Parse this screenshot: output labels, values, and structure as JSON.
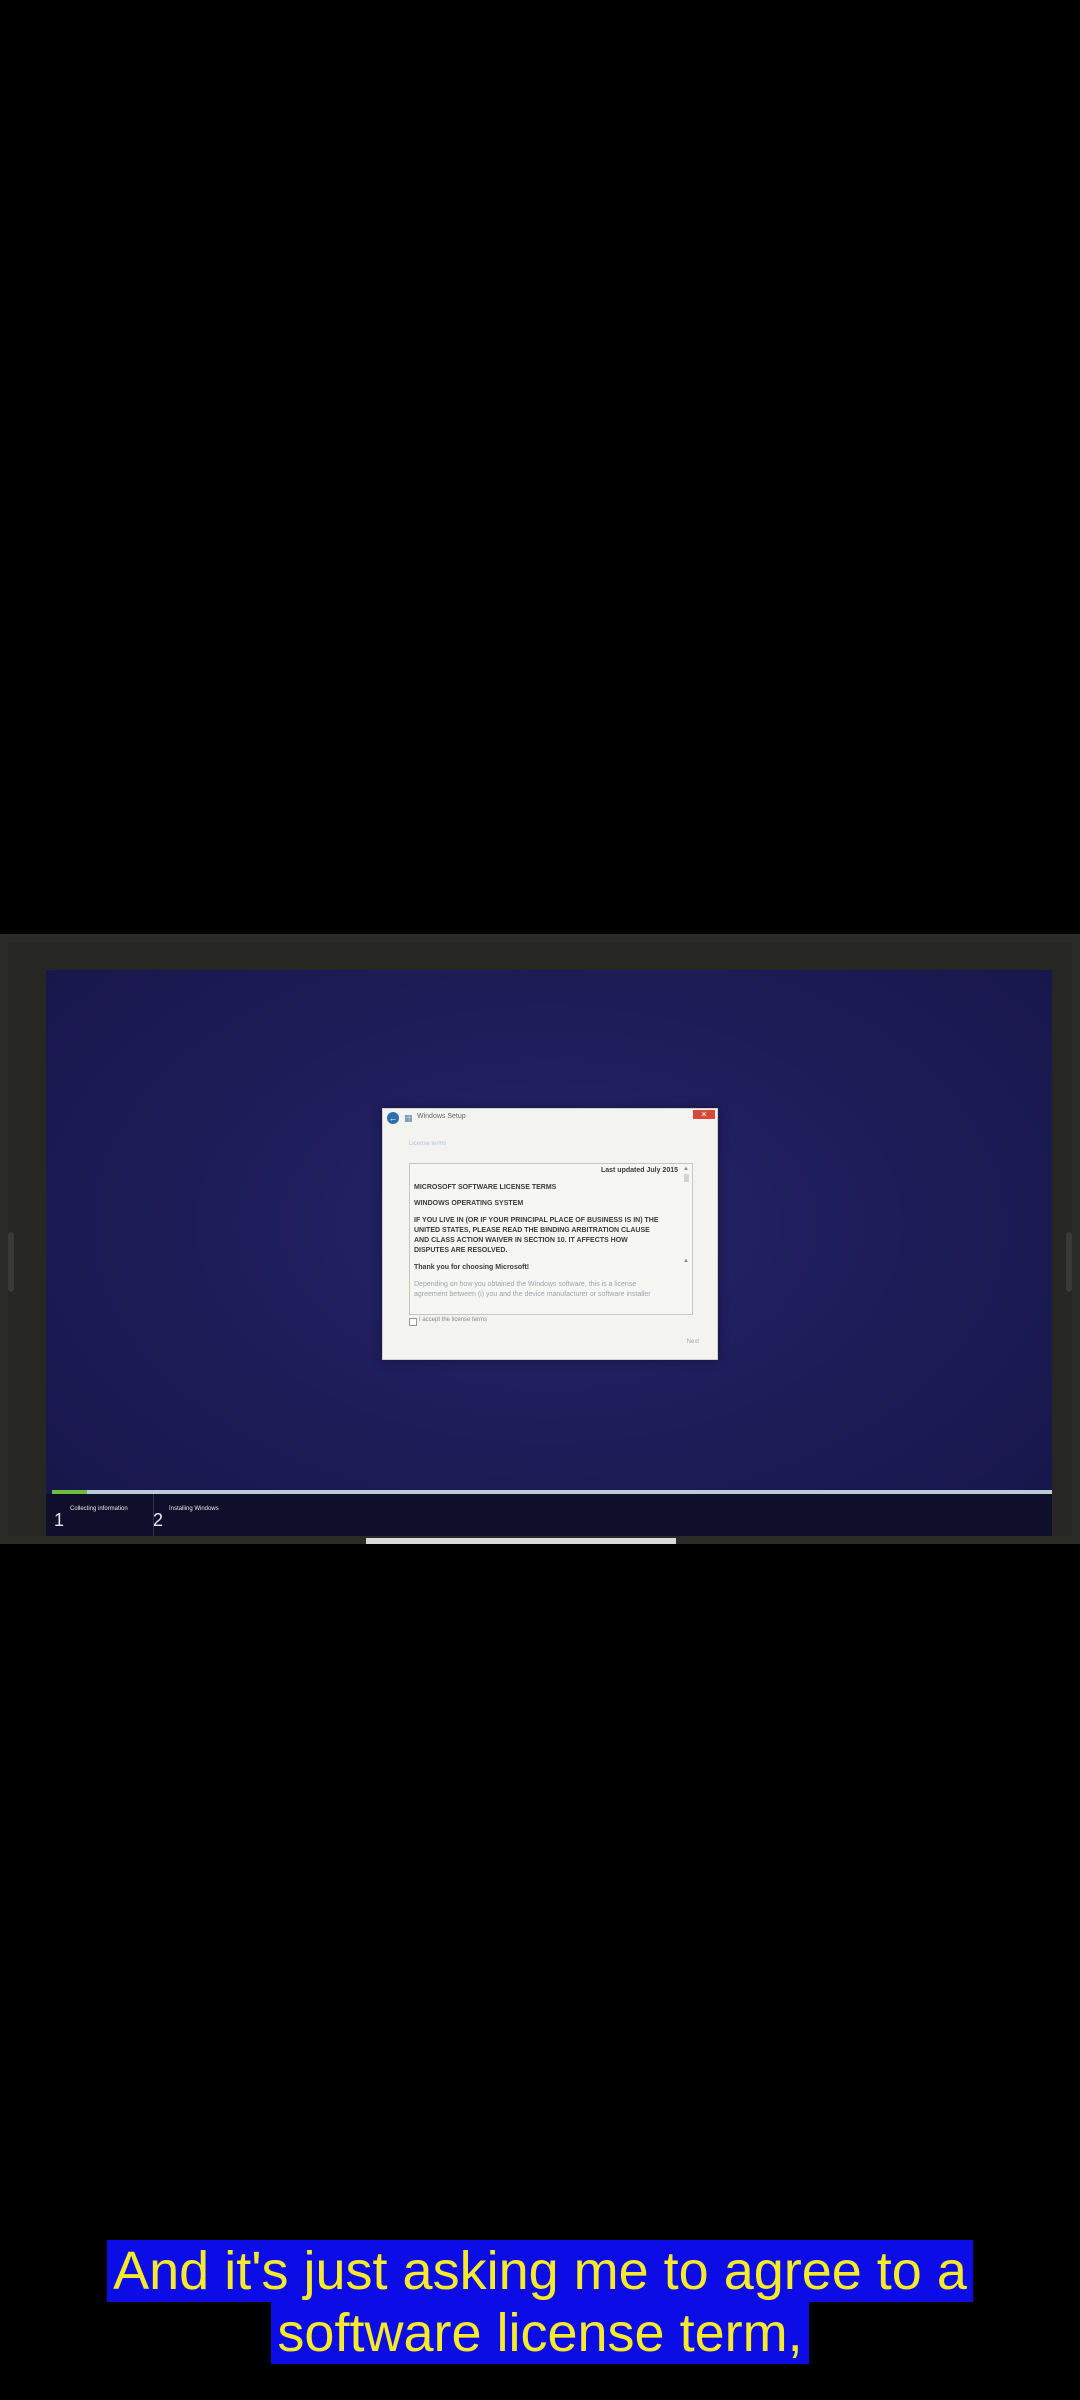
{
  "dialog": {
    "title": "Windows Setup",
    "heading": "License terms",
    "close_label": "✕",
    "back_icon": "back-arrow-icon",
    "setup_icon": "windows-setup-icon",
    "license": {
      "last_updated": "Last updated July 2015",
      "title": "MICROSOFT SOFTWARE LICENSE TERMS",
      "product": "WINDOWS OPERATING SYSTEM",
      "arbitration": [
        "IF YOU LIVE IN (OR IF YOUR PRINCIPAL PLACE OF BUSINESS IS IN) THE",
        "UNITED STATES, PLEASE READ THE BINDING ARBITRATION CLAUSE",
        "AND CLASS ACTION WAIVER IN SECTION 10. IT AFFECTS HOW",
        "DISPUTES ARE RESOLVED."
      ],
      "thanks": "Thank you for choosing Microsoft!",
      "body": [
        "Depending on how you obtained the Windows software, this is a license",
        "agreement between (i) you and the device manufacturer or software installer"
      ]
    },
    "accept_label": "I accept the license terms",
    "next_label": "Next"
  },
  "progress": {
    "fraction": 0.035,
    "steps": [
      {
        "number": "1",
        "label": "Collecting information"
      },
      {
        "number": "2",
        "label": "Installing Windows"
      }
    ]
  },
  "caption": {
    "line1": "And it's just asking me to agree to a",
    "line2": "software license term,"
  },
  "colors": {
    "screen_bg": "#1e1d5a",
    "progress_fill": "#6dbd3d",
    "caption_bg": "#0b0ce6",
    "caption_text": "#f7ea2a"
  }
}
